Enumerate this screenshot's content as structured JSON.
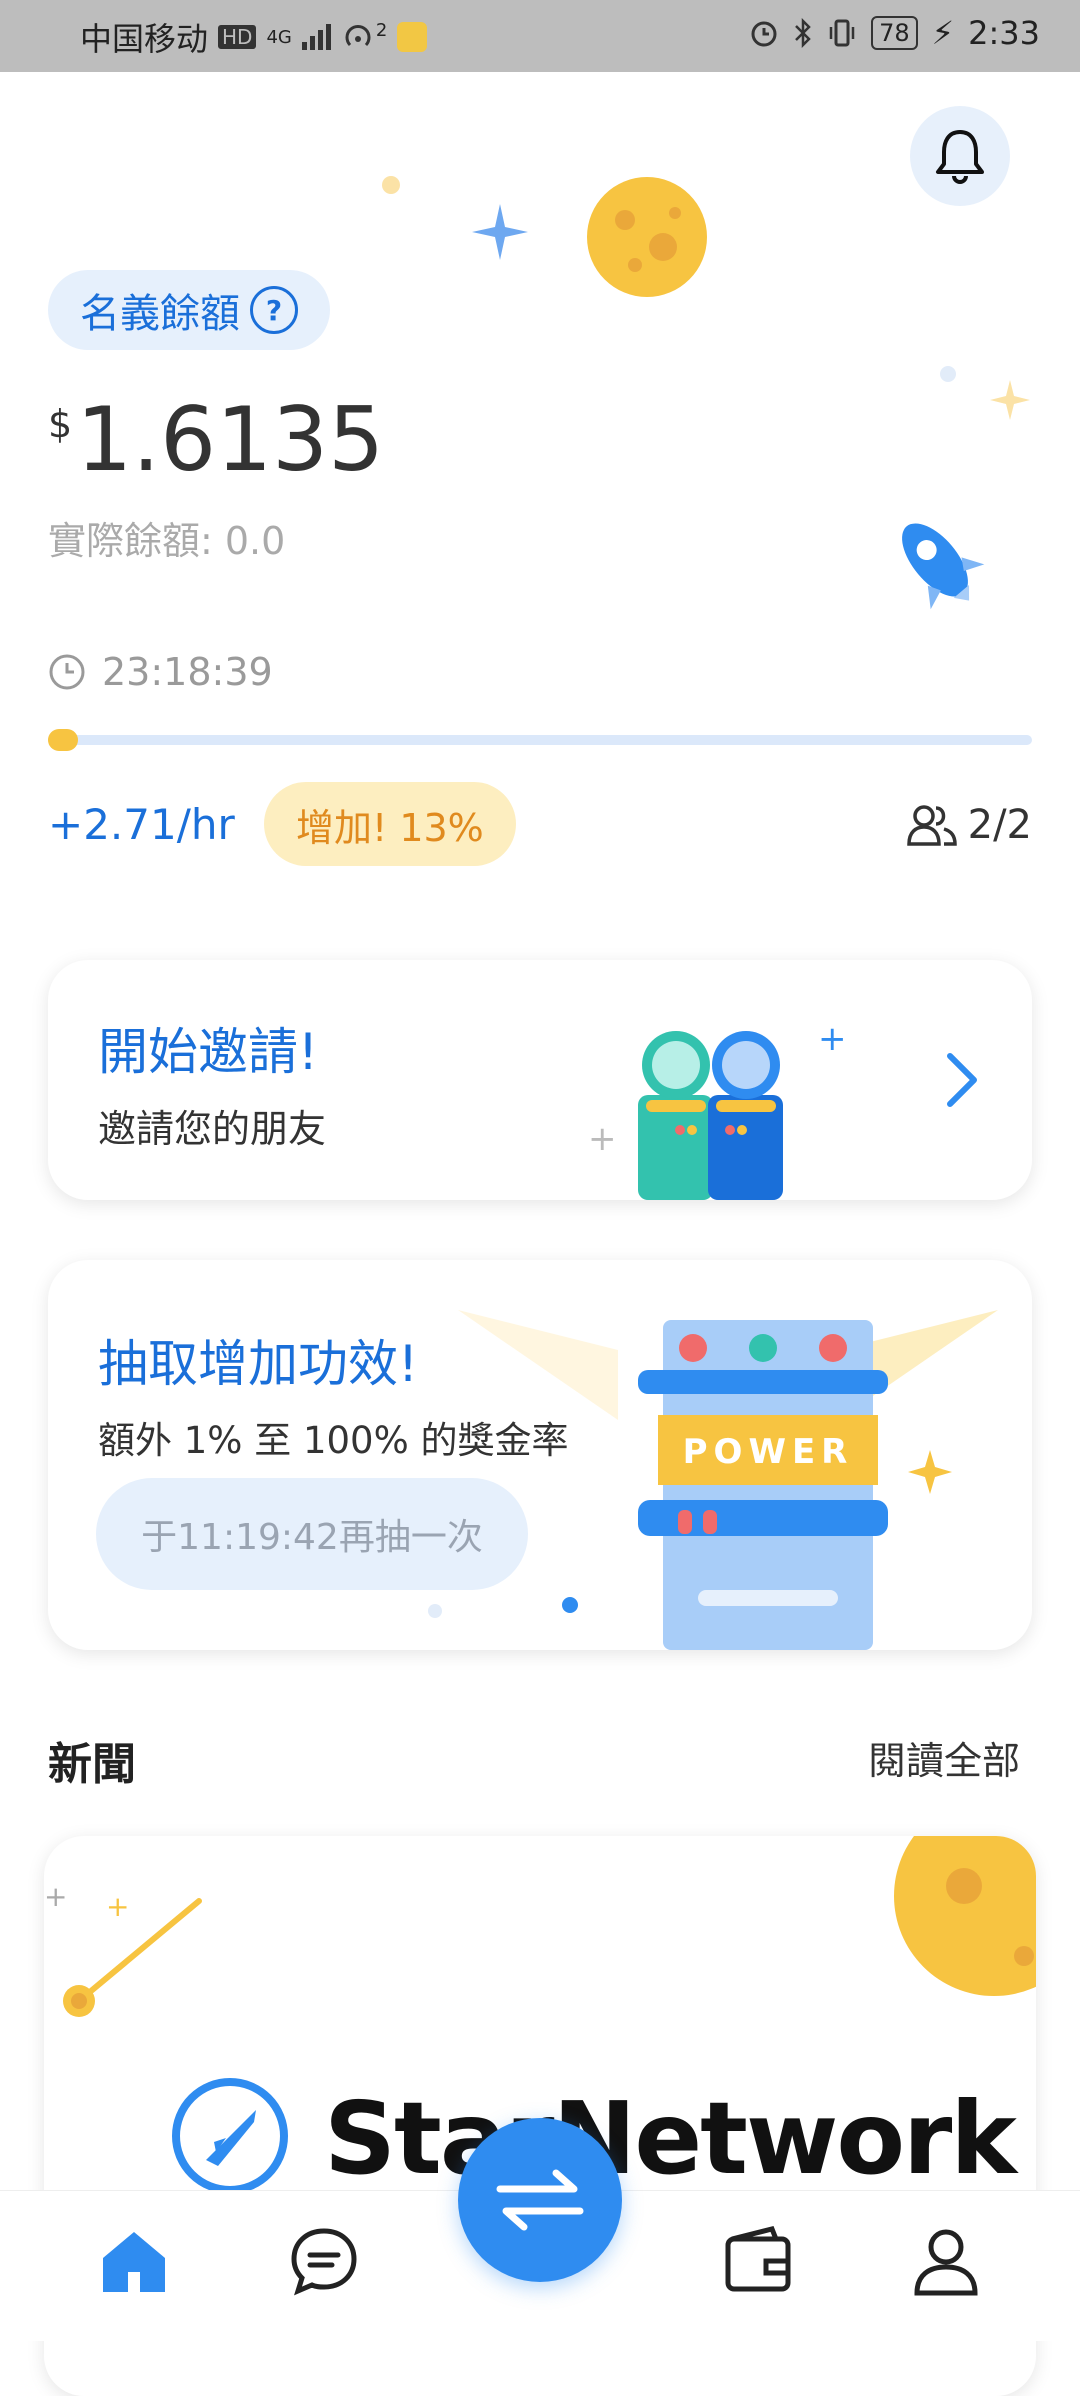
{
  "status_bar": {
    "carrier": "中国移动",
    "hd": "HD",
    "network": "4G",
    "hotspot_count": "2",
    "battery": "78",
    "time": "2:33"
  },
  "balance": {
    "label": "名義餘額",
    "help_icon": "?",
    "currency_symbol": "$",
    "value": "1.6135",
    "actual": "實際餘額: 0.0",
    "timer": "23:18:39",
    "progress_fraction": 0.02,
    "rate": "+2.71/hr",
    "boost": "增加! 13%",
    "users": "2/2"
  },
  "invite_card": {
    "title": "開始邀請!",
    "subtitle": "邀請您的朋友"
  },
  "boost_card": {
    "title": "抽取增加功效!",
    "subtitle": "額外 1% 至 100% 的獎金率",
    "button": "于11:19:42再抽一次",
    "illustration_label": "POWER"
  },
  "news": {
    "title": "新聞",
    "read_all": "閱讀全部",
    "banner_text": "StarNetwork"
  },
  "colors": {
    "accent": "#1a6fd9",
    "fab": "#2f8cf0",
    "boost_bg": "#fdeec0",
    "boost_text": "#e08a1e",
    "moon": "#f7c441"
  },
  "icons": {
    "bell": "bell-icon",
    "clock": "clock-icon",
    "users": "users-icon",
    "chevron": "chevron-right-icon",
    "home": "home-icon",
    "chat": "chat-icon",
    "swap": "swap-icon",
    "wallet": "wallet-icon",
    "profile": "profile-icon"
  }
}
